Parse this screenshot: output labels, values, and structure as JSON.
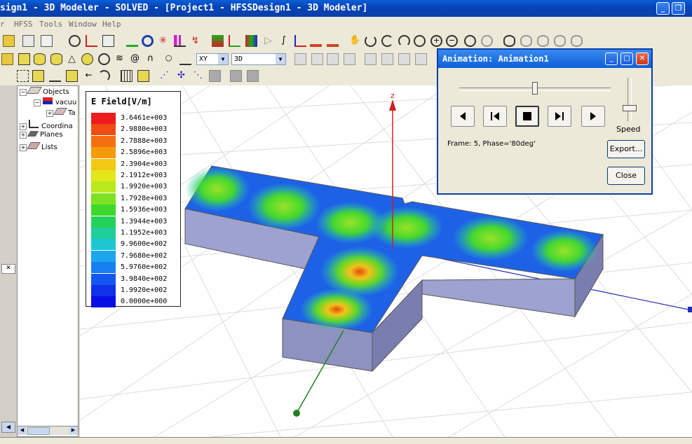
{
  "window": {
    "title": "sign1 - 3D Modeler - SOLVED - [Project1 - HFSSDesign1 - 3D Modeler]",
    "minimize": "_",
    "restore": "❐",
    "close": "✕"
  },
  "menu": [
    "r",
    "HFSS",
    "Tools",
    "Window",
    "Help"
  ],
  "toolbar3": {
    "plane_combo": "XY",
    "view_combo": "3D"
  },
  "tree": {
    "items": [
      "Objects",
      "vacuu",
      "Ta",
      "Coordina",
      "Planes",
      "Lists"
    ]
  },
  "legend": {
    "title": "E Field[V/m]",
    "entries": [
      {
        "value": "3.6461e+003",
        "color": "#ee1c1c"
      },
      {
        "value": "2.9880e+003",
        "color": "#f14a12"
      },
      {
        "value": "2.7888e+003",
        "color": "#f3700e"
      },
      {
        "value": "2.5896e+003",
        "color": "#f59a0b"
      },
      {
        "value": "2.3904e+003",
        "color": "#f2c812"
      },
      {
        "value": "2.1912e+003",
        "color": "#e2e61a"
      },
      {
        "value": "1.9920e+003",
        "color": "#b8ea1e"
      },
      {
        "value": "1.7928e+003",
        "color": "#7ee224"
      },
      {
        "value": "1.5936e+003",
        "color": "#3ed82a"
      },
      {
        "value": "1.3944e+003",
        "color": "#24d25a"
      },
      {
        "value": "1.1952e+003",
        "color": "#1ecf9a"
      },
      {
        "value": "9.9600e+002",
        "color": "#1cc7d2"
      },
      {
        "value": "7.9680e+002",
        "color": "#1aa7ee"
      },
      {
        "value": "5.9760e+002",
        "color": "#1680f2"
      },
      {
        "value": "3.9840e+002",
        "color": "#1456f0"
      },
      {
        "value": "1.9920e+002",
        "color": "#1030ea"
      },
      {
        "value": "0.0000e+000",
        "color": "#0a10e2"
      }
    ]
  },
  "viewport": {
    "z_axis_label": "z"
  },
  "animation": {
    "title": "Animation: Animation1",
    "frame_text": "Frame: 5, Phase='80deg'",
    "speed_label": "Speed",
    "export_label": "Export...",
    "close_label": "Close",
    "frame_position": 0.5,
    "speed_level": 0.3
  },
  "colors": {
    "titlebar": "#0a5fd8",
    "menubar": "#ece9d8",
    "z_axis": "#d02020",
    "y_axis": "#208020",
    "x_axis": "#2030b0",
    "box_side": "#8e92c0"
  }
}
